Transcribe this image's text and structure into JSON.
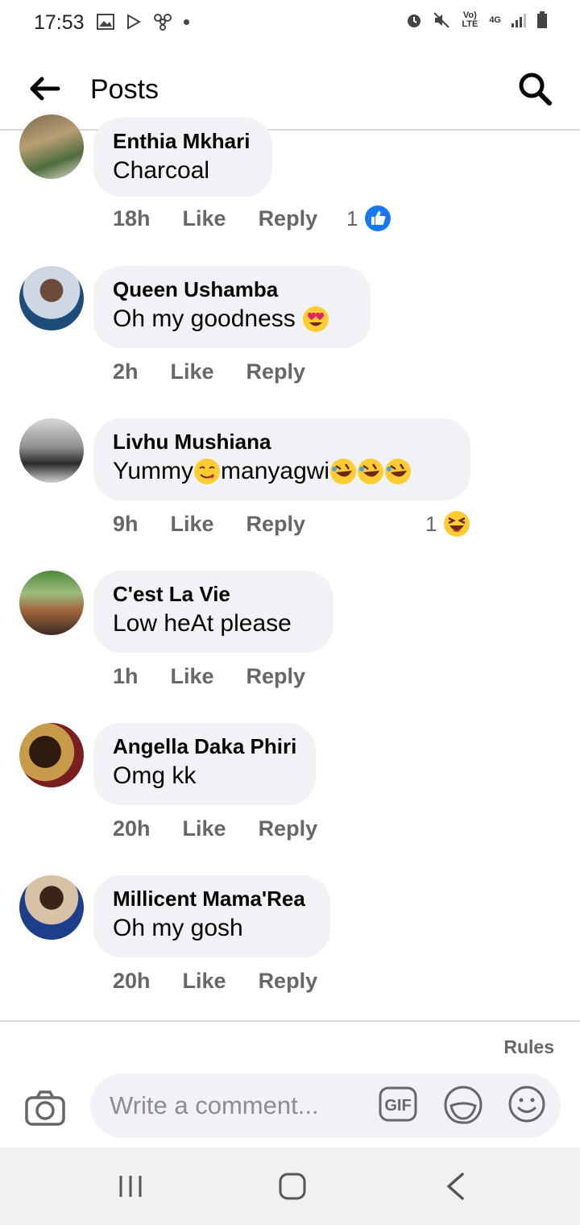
{
  "status_bar": {
    "time": "17:53",
    "network_label": "Vo) LTE",
    "network_type": "4G"
  },
  "header": {
    "title": "Posts"
  },
  "comments": [
    {
      "name": "Enthia Mkhari",
      "text": "Charcoal",
      "time": "18h",
      "like": "Like",
      "reply": "Reply",
      "reaction_count": "1",
      "reaction": "like-icon"
    },
    {
      "name": "Queen Ushamba",
      "text": "Oh my goodness",
      "emoji": "heart-eyes-emoji",
      "time": "2h",
      "like": "Like",
      "reply": "Reply"
    },
    {
      "name": "Livhu Mushiana",
      "text_a": "Yummy",
      "text_b": "manyagwi",
      "time": "9h",
      "like": "Like",
      "reply": "Reply",
      "reaction_count": "1",
      "reaction": "haha-icon"
    },
    {
      "name": "C'est La Vie",
      "text": "Low heAt please",
      "time": "1h",
      "like": "Like",
      "reply": "Reply"
    },
    {
      "name": "Angella Daka Phiri",
      "text": "Omg kk",
      "time": "20h",
      "like": "Like",
      "reply": "Reply"
    },
    {
      "name": "Millicent Mama'Rea",
      "text": "Oh my gosh",
      "time": "20h",
      "like": "Like",
      "reply": "Reply"
    }
  ],
  "composer": {
    "rules": "Rules",
    "placeholder": "Write a comment...",
    "gif_label": "GIF"
  },
  "colors": {
    "like_blue": "#1877f2",
    "bubble_gray": "#f0f2f5",
    "meta_gray": "#65676b",
    "emoji_yellow": "#ffcc33"
  }
}
